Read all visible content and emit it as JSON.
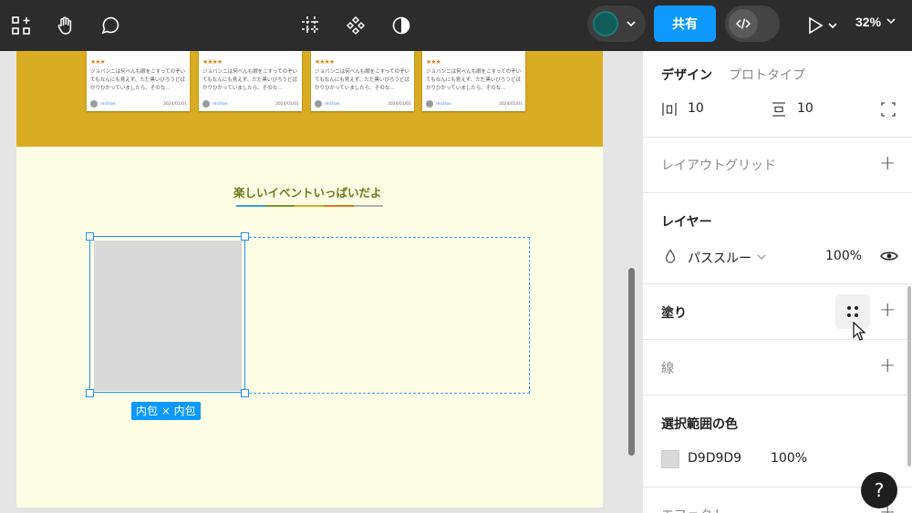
{
  "toolbar": {
    "share_label": "共有",
    "zoom": "32%",
    "icons": [
      "frame-tools-icon",
      "hand-icon",
      "comment-icon",
      "frame-icon",
      "component-icon",
      "contrast-icon",
      "play-icon"
    ],
    "avatar_color": "#0f5c5a",
    "accent": "#0d99ff"
  },
  "canvas": {
    "review_cards": [
      {
        "stars": "★★★",
        "text": "ジョバンニは何べんも眼をこすってのぞいてもなんにも見えず、ただ黒いびろうどばかりひかっていましたら、そのな…",
        "user": "michan",
        "date": "2024/01/01"
      },
      {
        "stars": "★★★★",
        "text": "ジョバンニは何べんも眼をこすってのぞいてもなんにも見えず、ただ黒いびろうどばかりひかっていましたら、そのな…",
        "user": "michan",
        "date": "2024/01/01"
      },
      {
        "stars": "★★★★",
        "text": "ジョバンニは何べんも眼をこすってのぞいてもなんにも見えず、ただ黒いびろうどばかりひかっていましたら、そのな…",
        "user": "michan",
        "date": "2024/01/01"
      },
      {
        "stars": "★★★",
        "text": "ジョバンニは何べんも眼をこすってのぞいてもなんにも見えず、ただ黒いびろうどばかりひかっていましたら、そのな…",
        "user": "michan",
        "date": "2024/01/01"
      }
    ],
    "section_title": "楽しいイベントいっぱいだよ",
    "size_label": "内包 × 内包",
    "colors": {
      "gold": "#d9ad23",
      "cream": "#fdfde6",
      "title": "#6b7d17"
    }
  },
  "panel": {
    "tabs": {
      "design": "デザイン",
      "prototype": "プロトタイプ"
    },
    "padding": {
      "horizontal": "10",
      "vertical": "10"
    },
    "layout_grid": "レイアウトグリッド",
    "layer": {
      "title": "レイヤー",
      "blend": "パススルー",
      "opacity": "100%"
    },
    "fill": {
      "title": "塗り"
    },
    "stroke": {
      "title": "線"
    },
    "selection_colors": {
      "title": "選択範囲の色",
      "hex": "D9D9D9",
      "opacity": "100%"
    },
    "effects": {
      "title": "エフェクト"
    },
    "help": "?"
  }
}
